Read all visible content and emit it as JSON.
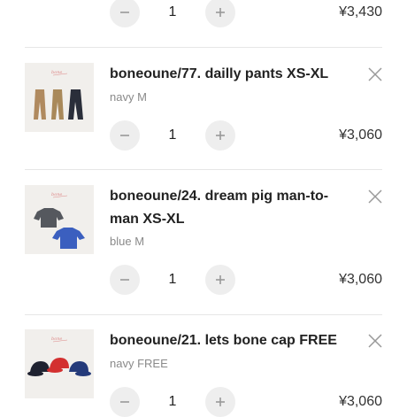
{
  "cart": {
    "partial_item": {
      "quantity": "1",
      "price": "¥3,430"
    },
    "items": [
      {
        "title": "boneoune/77. dailly pants XS-XL",
        "variant": "navy M",
        "quantity": "1",
        "price": "¥3,060",
        "image_icon": "pants-product-image"
      },
      {
        "title": "boneoune/24. dream pig man-to-man XS-XL",
        "variant": "blue M",
        "quantity": "1",
        "price": "¥3,060",
        "image_icon": "sweatshirt-product-image"
      },
      {
        "title": "boneoune/21. lets bone cap FREE",
        "variant": "navy FREE",
        "quantity": "1",
        "price": "¥3,060",
        "image_icon": "cap-product-image"
      }
    ]
  },
  "colors": {
    "button_bg": "#eeeeee",
    "divider": "#e6e6e6",
    "variant_text": "#8a8a8a"
  }
}
